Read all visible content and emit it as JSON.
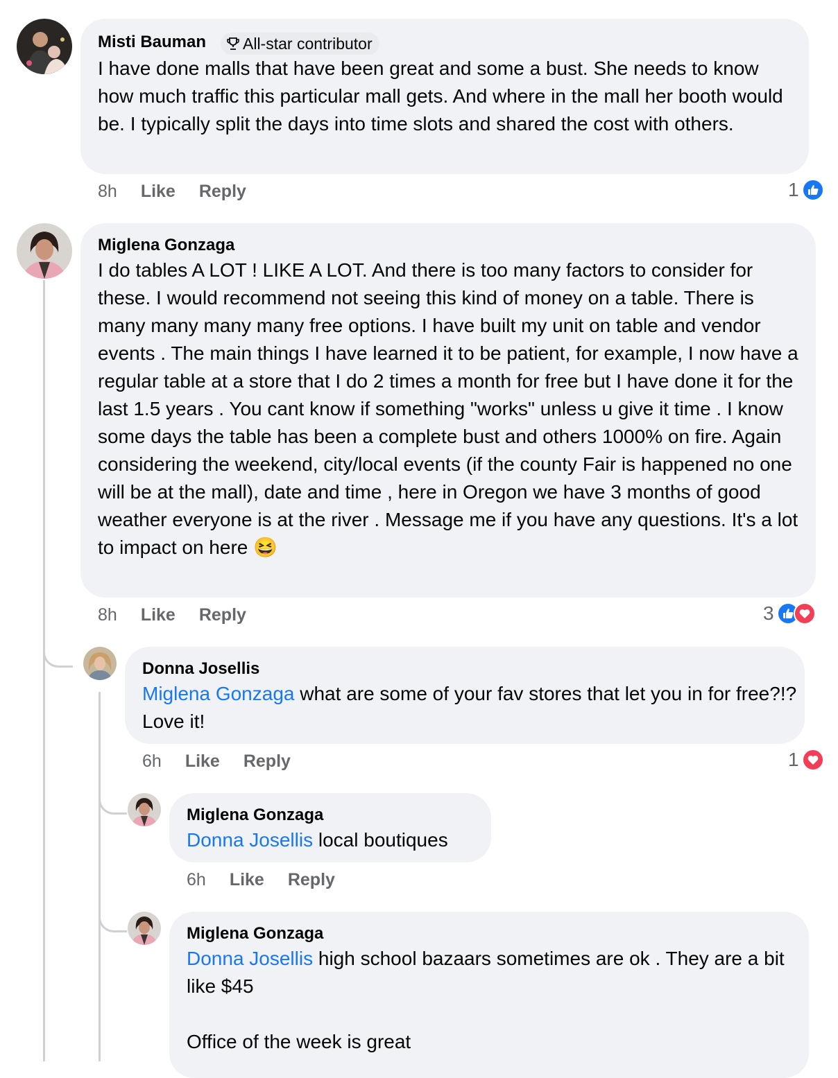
{
  "comments": [
    {
      "author": "Misti Bauman",
      "badge": "All-star contributor",
      "text": "I have done malls that have been great and some a bust. She needs to know how much traffic this particular mall gets. And where in the mall her booth would be. I typically split the days into time slots and shared the cost with others.",
      "time": "8h",
      "like_label": "Like",
      "reply_label": "Reply",
      "reaction_count": "1",
      "reactions": [
        "like-icon"
      ]
    },
    {
      "author": "Miglena Gonzaga",
      "text": "I do tables A LOT ! LIKE A LOT. And there is too many factors to consider for these. I would recommend not seeing this kind of money on a table. There is many many many many free options. I have built my unit on table and vendor events . The main things I have learned it to be patient, for example, I now have a regular table at a store that I do 2 times a month for free but I have done it for the last 1.5 years . You cant know if something \"works\" unless u give it time . I know some days the table has been a complete bust and others 1000% on fire. Again considering the weekend, city/local events (if the county Fair is happened no one will be at the mall), date and time , here in Oregon we have 3 months of good weather everyone is at the river . Message me if you have any questions. It's a lot to impact on here",
      "emoji": "😆",
      "time": "8h",
      "like_label": "Like",
      "reply_label": "Reply",
      "reaction_count": "3",
      "reactions": [
        "like-icon",
        "love-icon"
      ],
      "replies": [
        {
          "author": "Donna Josellis",
          "mention": "Miglena Gonzaga",
          "text": " what are some of your fav stores that let you in for free?!?  Love it!",
          "time": "6h",
          "like_label": "Like",
          "reply_label": "Reply",
          "reaction_count": "1",
          "reactions": [
            "love-icon"
          ],
          "replies": [
            {
              "author": "Miglena Gonzaga",
              "mention": "Donna Josellis",
              "text": " local boutiques",
              "time": "6h",
              "like_label": "Like",
              "reply_label": "Reply"
            },
            {
              "author": "Miglena Gonzaga",
              "mention": "Donna Josellis",
              "text": " high school bazaars sometimes are ok . They are a bit like $45",
              "text2": "Office of the week is great"
            }
          ]
        }
      ]
    }
  ],
  "colors": {
    "bubble": "#f0f2f5",
    "mention": "#1877f2",
    "meta": "#65676b",
    "like": "#1877f2",
    "love": "#f33e58"
  }
}
